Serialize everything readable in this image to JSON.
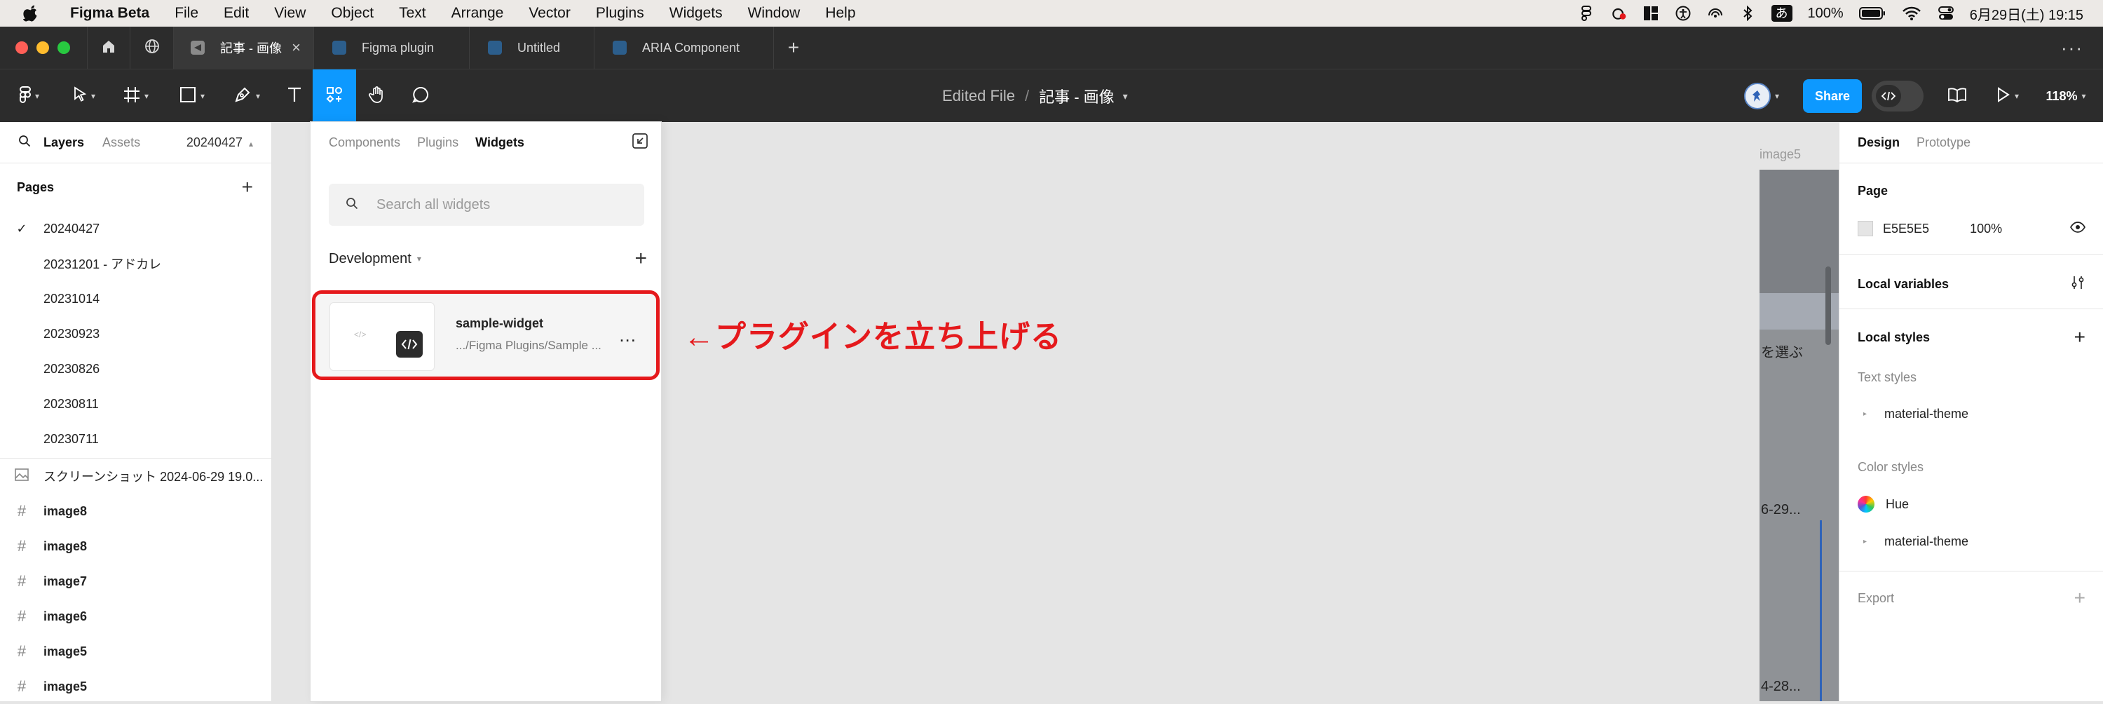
{
  "menubar": {
    "app_name": "Figma Beta",
    "menus": [
      "File",
      "Edit",
      "View",
      "Object",
      "Text",
      "Arrange",
      "Vector",
      "Plugins",
      "Widgets",
      "Window",
      "Help"
    ],
    "ime": "あ",
    "battery": "100%",
    "datetime": "6月29日(土)  19:15"
  },
  "tabs": [
    {
      "label": "記事 - 画像",
      "active": true
    },
    {
      "label": "Figma plugin",
      "active": false
    },
    {
      "label": "Untitled",
      "active": false
    },
    {
      "label": "ARIA Component",
      "active": false
    }
  ],
  "toolbar": {
    "breadcrumb_file": "Edited File",
    "breadcrumb_sep": "/",
    "document_title": "記事 - 画像",
    "share_label": "Share",
    "zoom": "118%"
  },
  "left_panel": {
    "tabs": [
      "Layers",
      "Assets"
    ],
    "current_page": "20240427",
    "pages_title": "Pages",
    "pages": [
      "20240427",
      "20231201 - アドカレ",
      "20231014",
      "20230923",
      "20230826",
      "20230811",
      "20230711"
    ],
    "layers": [
      {
        "label": "スクリーンショット 2024-06-29 19.0...",
        "type": "image"
      },
      {
        "label": "image8",
        "type": "frame"
      },
      {
        "label": "image8",
        "type": "frame"
      },
      {
        "label": "image7",
        "type": "frame"
      },
      {
        "label": "image6",
        "type": "frame"
      },
      {
        "label": "image5",
        "type": "frame"
      },
      {
        "label": "image5",
        "type": "frame"
      }
    ]
  },
  "widget_panel": {
    "tabs": [
      "Components",
      "Plugins",
      "Widgets"
    ],
    "active_tab": "Widgets",
    "search_placeholder": "Search all widgets",
    "section_title": "Development",
    "widget": {
      "name": "sample-widget",
      "path": ".../Figma Plugins/Sample ...",
      "more": "..."
    }
  },
  "canvas": {
    "frame_label": "image5",
    "fragments": [
      "を選ぶ",
      "6-29...",
      "4-28..."
    ],
    "annotation": "←プラグインを立ち上げる",
    "annotation_color": "#e5191c"
  },
  "right_panel": {
    "tabs": [
      "Design",
      "Prototype"
    ],
    "page_title": "Page",
    "page_color": "E5E5E5",
    "page_opacity": "100%",
    "local_variables": "Local variables",
    "local_styles": "Local styles",
    "text_styles": "Text styles",
    "text_style_items": [
      "material-theme"
    ],
    "color_styles": "Color styles",
    "color_style_items": [
      "Hue",
      "material-theme"
    ],
    "export": "Export"
  },
  "colors": {
    "accent": "#0d99ff",
    "dark": "#2c2c2c",
    "highlight": "#e5191c"
  }
}
